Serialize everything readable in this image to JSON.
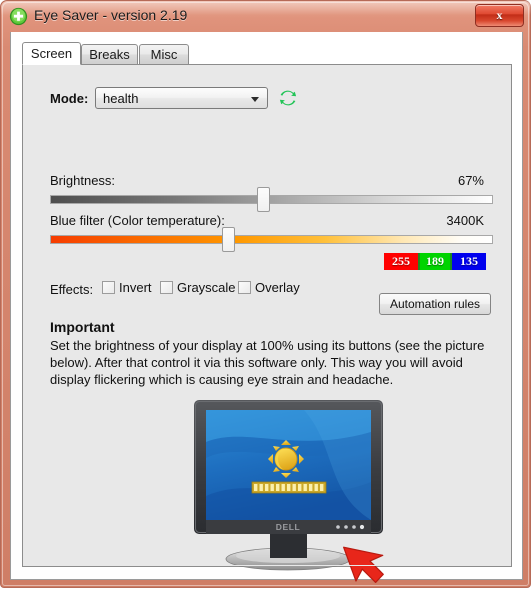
{
  "window": {
    "title": "Eye Saver - version 2.19",
    "app_icon": "green-shield-plus-icon",
    "close_label": "x",
    "frame_color": "#d2836d"
  },
  "tabs": [
    {
      "label": "Screen",
      "active": true
    },
    {
      "label": "Breaks",
      "active": false
    },
    {
      "label": "Misc",
      "active": false
    }
  ],
  "screen_tab": {
    "mode": {
      "label": "Mode:",
      "value": "health",
      "refresh_icon": "refresh-arrows-icon",
      "refresh_color": "#22c457"
    },
    "brightness": {
      "label": "Brightness:",
      "value": "67%",
      "percent": 67
    },
    "blue_filter": {
      "label": "Blue filter (Color temperature):",
      "value": "3400K",
      "kelvin": 3400,
      "percent": 39
    },
    "rgb": {
      "r": "255",
      "g": "189",
      "b": "135",
      "r_color": "#ff0000",
      "g_color": "#00d400",
      "b_color": "#0000ee"
    },
    "effects": {
      "label": "Effects:",
      "items": [
        {
          "label": "Invert",
          "checked": false
        },
        {
          "label": "Grayscale",
          "checked": false
        },
        {
          "label": "Overlay",
          "checked": false
        }
      ]
    },
    "automation_button": "Automation rules",
    "important": {
      "title": "Important",
      "body": "Set the brightness of your display at 100% using its buttons (see the picture below). After that control it via this software only. This way you will avoid display flickering which is causing eye strain and headache."
    },
    "illustration": {
      "monitor_brand": "DELL",
      "osd_icon": "brightness-sun-icon",
      "osd_level_segments": 13,
      "pointer": "red-arrow-cursor",
      "pointer_color": "#e8261a"
    }
  }
}
